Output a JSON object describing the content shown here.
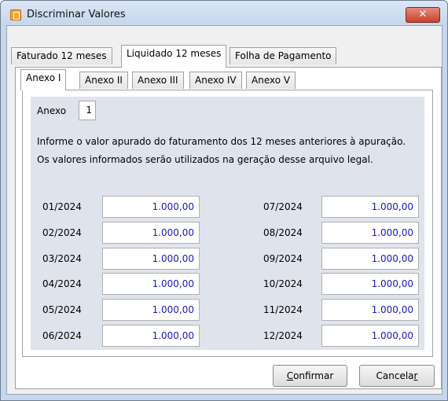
{
  "window": {
    "title": "Discriminar Valores",
    "close_glyph": "✕"
  },
  "top_tabs": [
    {
      "label": "Faturado 12 meses",
      "active": false
    },
    {
      "label": "Liquidado 12 meses",
      "active": true
    },
    {
      "label": "Folha de Pagamento",
      "active": false
    }
  ],
  "anexo_tabs": [
    {
      "label": "Anexo I",
      "active": true
    },
    {
      "label": "Anexo II",
      "active": false
    },
    {
      "label": "Anexo III",
      "active": false
    },
    {
      "label": "Anexo IV",
      "active": false
    },
    {
      "label": "Anexo V",
      "active": false
    }
  ],
  "anexo": {
    "label": "Anexo",
    "value": "1"
  },
  "info": {
    "line1": "Informe o valor apurado do faturamento dos 12 meses anteriores à apuração.",
    "line2": "Os valores informados serão utilizados na geração desse arquivo legal."
  },
  "months_left": [
    {
      "month": "01/2024",
      "value": "1.000,00"
    },
    {
      "month": "02/2024",
      "value": "1.000,00"
    },
    {
      "month": "03/2024",
      "value": "1.000,00"
    },
    {
      "month": "04/2024",
      "value": "1.000,00"
    },
    {
      "month": "05/2024",
      "value": "1.000,00"
    },
    {
      "month": "06/2024",
      "value": "1.000,00"
    }
  ],
  "months_right": [
    {
      "month": "07/2024",
      "value": "1.000,00"
    },
    {
      "month": "08/2024",
      "value": "1.000,00"
    },
    {
      "month": "09/2024",
      "value": "1.000,00"
    },
    {
      "month": "10/2024",
      "value": "1.000,00"
    },
    {
      "month": "11/2024",
      "value": "1.000,00"
    },
    {
      "month": "12/2024",
      "value": "1.000,00"
    }
  ],
  "buttons": {
    "confirm": {
      "underlined": "C",
      "rest": "onfirmar"
    },
    "cancel": {
      "start": "Cancela",
      "underlined": "r"
    }
  },
  "colors": {
    "value_text": "#1a1ab0",
    "close_button": "#c9422c",
    "content_bg": "#dfe3ec"
  },
  "icons": {
    "app": "app-icon",
    "close": "close-icon"
  }
}
